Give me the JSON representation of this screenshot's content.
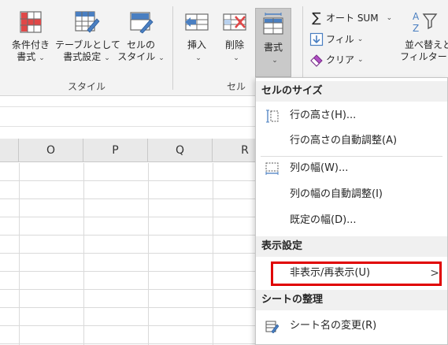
{
  "ribbon": {
    "style_group": {
      "label": "スタイル",
      "conditional_format": {
        "line1": "条件付き",
        "line2": "書式"
      },
      "format_as_table": {
        "line1": "テーブルとして",
        "line2": "書式設定"
      },
      "cell_styles": {
        "line1": "セルの",
        "line2": "スタイル"
      }
    },
    "cells_group": {
      "label": "セル",
      "insert": {
        "label": "挿入"
      },
      "delete": {
        "label": "削除"
      },
      "format": {
        "label": "書式"
      }
    },
    "editing_group": {
      "autosum": {
        "label": "オート SUM"
      },
      "fill": {
        "label": "フィル"
      },
      "clear": {
        "label": "クリア"
      },
      "sort_filter": {
        "line1": "並べ替えと",
        "line2": "フィルター"
      }
    },
    "caret": "⌄"
  },
  "grid": {
    "columns": [
      "O",
      "P",
      "Q",
      "R"
    ]
  },
  "format_menu": {
    "section_cell_size": "セルのサイズ",
    "row_height": "行の高さ(H)...",
    "autofit_row": "行の高さの自動調整(A)",
    "column_width": "列の幅(W)...",
    "autofit_column": "列の幅の自動調整(I)",
    "default_width": "既定の幅(D)...",
    "section_visibility": "表示設定",
    "hide_unhide": "非表示/再表示(U)",
    "submenu_arrow": ">",
    "section_organize": "シートの整理",
    "rename_sheet": "シート名の変更(R)"
  },
  "colors": {
    "highlight": "#e00000",
    "ribbon_bg": "#f3f3f3",
    "icon_blue": "#4a7fc1",
    "icon_red": "#e04848"
  }
}
